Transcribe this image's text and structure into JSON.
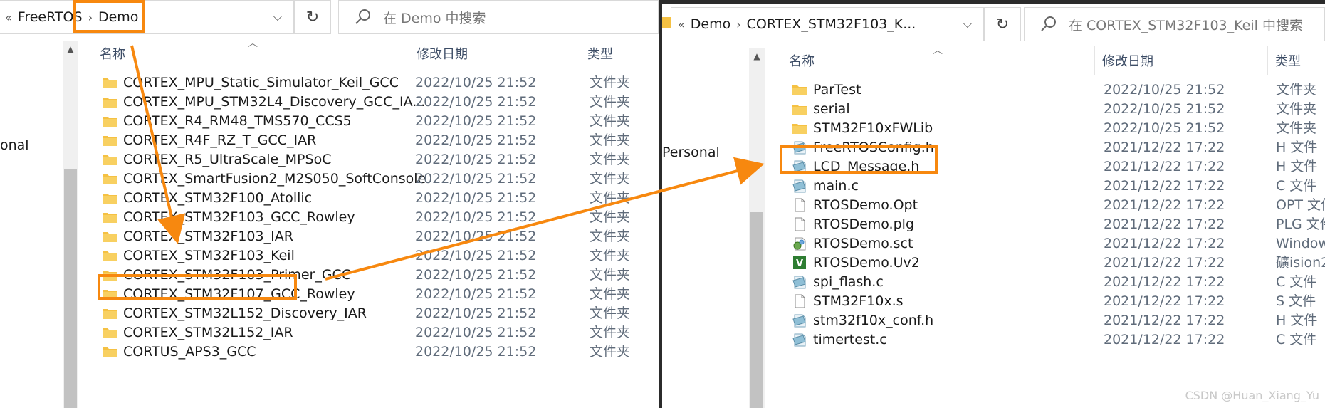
{
  "left": {
    "breadcrumb": [
      "FreeRTOS",
      "Demo"
    ],
    "search_placeholder": "在 Demo 中搜索",
    "nav_partial": "onal",
    "columns": {
      "name": "名称",
      "date": "修改日期",
      "type": "类型"
    },
    "rows": [
      {
        "name": "CORTEX_MPU_Static_Simulator_Keil_GCC",
        "date": "2022/10/25 21:52",
        "type": "文件夹"
      },
      {
        "name": "CORTEX_MPU_STM32L4_Discovery_GCC_IA...",
        "date": "2022/10/25 21:52",
        "type": "文件夹"
      },
      {
        "name": "CORTEX_R4_RM48_TMS570_CCS5",
        "date": "2022/10/25 21:52",
        "type": "文件夹"
      },
      {
        "name": "CORTEX_R4F_RZ_T_GCC_IAR",
        "date": "2022/10/25 21:52",
        "type": "文件夹"
      },
      {
        "name": "CORTEX_R5_UltraScale_MPSoC",
        "date": "2022/10/25 21:52",
        "type": "文件夹"
      },
      {
        "name": "CORTEX_SmartFusion2_M2S050_SoftConsole",
        "date": "2022/10/25 21:52",
        "type": "文件夹"
      },
      {
        "name": "CORTEX_STM32F100_Atollic",
        "date": "2022/10/25 21:52",
        "type": "文件夹"
      },
      {
        "name": "CORTEX_STM32F103_GCC_Rowley",
        "date": "2022/10/25 21:52",
        "type": "文件夹"
      },
      {
        "name": "CORTEX_STM32F103_IAR",
        "date": "2022/10/25 21:52",
        "type": "文件夹"
      },
      {
        "name": "CORTEX_STM32F103_Keil",
        "date": "2022/10/25 21:52",
        "type": "文件夹"
      },
      {
        "name": "CORTEX_STM32F103_Primer_GCC",
        "date": "2022/10/25 21:52",
        "type": "文件夹"
      },
      {
        "name": "CORTEX_STM32F107_GCC_Rowley",
        "date": "2022/10/25 21:52",
        "type": "文件夹"
      },
      {
        "name": "CORTEX_STM32L152_Discovery_IAR",
        "date": "2022/10/25 21:52",
        "type": "文件夹"
      },
      {
        "name": "CORTEX_STM32L152_IAR",
        "date": "2022/10/25 21:52",
        "type": "文件夹"
      },
      {
        "name": "CORTUS_APS3_GCC",
        "date": "2022/10/25 21:52",
        "type": "文件夹"
      }
    ]
  },
  "right": {
    "breadcrumb": [
      "Demo",
      "CORTEX_STM32F103_K..."
    ],
    "search_placeholder": "在 CORTEX_STM32F103_Keil 中搜索",
    "nav_partial": "Personal",
    "columns": {
      "name": "名称",
      "date": "修改日期",
      "type": "类型"
    },
    "rows": [
      {
        "name": "ParTest",
        "date": "2022/10/25 21:52",
        "type": "文件夹",
        "icon": "folder-icon"
      },
      {
        "name": "serial",
        "date": "2022/10/25 21:52",
        "type": "文件夹",
        "icon": "folder-icon"
      },
      {
        "name": "STM32F10xFWLib",
        "date": "2022/10/25 21:52",
        "type": "文件夹",
        "icon": "folder-icon"
      },
      {
        "name": "FreeRTOSConfig.h",
        "date": "2021/12/22 17:22",
        "type": "H 文件",
        "icon": "source-file-icon"
      },
      {
        "name": "LCD_Message.h",
        "date": "2021/12/22 17:22",
        "type": "H 文件",
        "icon": "source-file-icon"
      },
      {
        "name": "main.c",
        "date": "2021/12/22 17:22",
        "type": "C 文件",
        "icon": "source-file-icon"
      },
      {
        "name": "RTOSDemo.Opt",
        "date": "2021/12/22 17:22",
        "type": "OPT 文件",
        "icon": "blank-file-icon"
      },
      {
        "name": "RTOSDemo.plg",
        "date": "2021/12/22 17:22",
        "type": "PLG 文件",
        "icon": "blank-file-icon"
      },
      {
        "name": "RTOSDemo.sct",
        "date": "2021/12/22 17:22",
        "type": "Window",
        "icon": "script-file-icon"
      },
      {
        "name": "RTOSDemo.Uv2",
        "date": "2021/12/22 17:22",
        "type": "礦ision2",
        "icon": "uvision-file-icon"
      },
      {
        "name": "spi_flash.c",
        "date": "2021/12/22 17:22",
        "type": "C 文件",
        "icon": "source-file-icon"
      },
      {
        "name": "STM32F10x.s",
        "date": "2021/12/22 17:22",
        "type": "S 文件",
        "icon": "blank-file-icon"
      },
      {
        "name": "stm32f10x_conf.h",
        "date": "2021/12/22 17:22",
        "type": "H 文件",
        "icon": "source-file-icon"
      },
      {
        "name": "timertest.c",
        "date": "2021/12/22 17:22",
        "type": "C 文件",
        "icon": "source-file-icon"
      }
    ]
  },
  "watermark": "CSDN @Huan_Xiang_Yu",
  "colors": {
    "highlight": "#f7880f",
    "folder": "#f5c143",
    "divider": "#2b2b2b"
  }
}
